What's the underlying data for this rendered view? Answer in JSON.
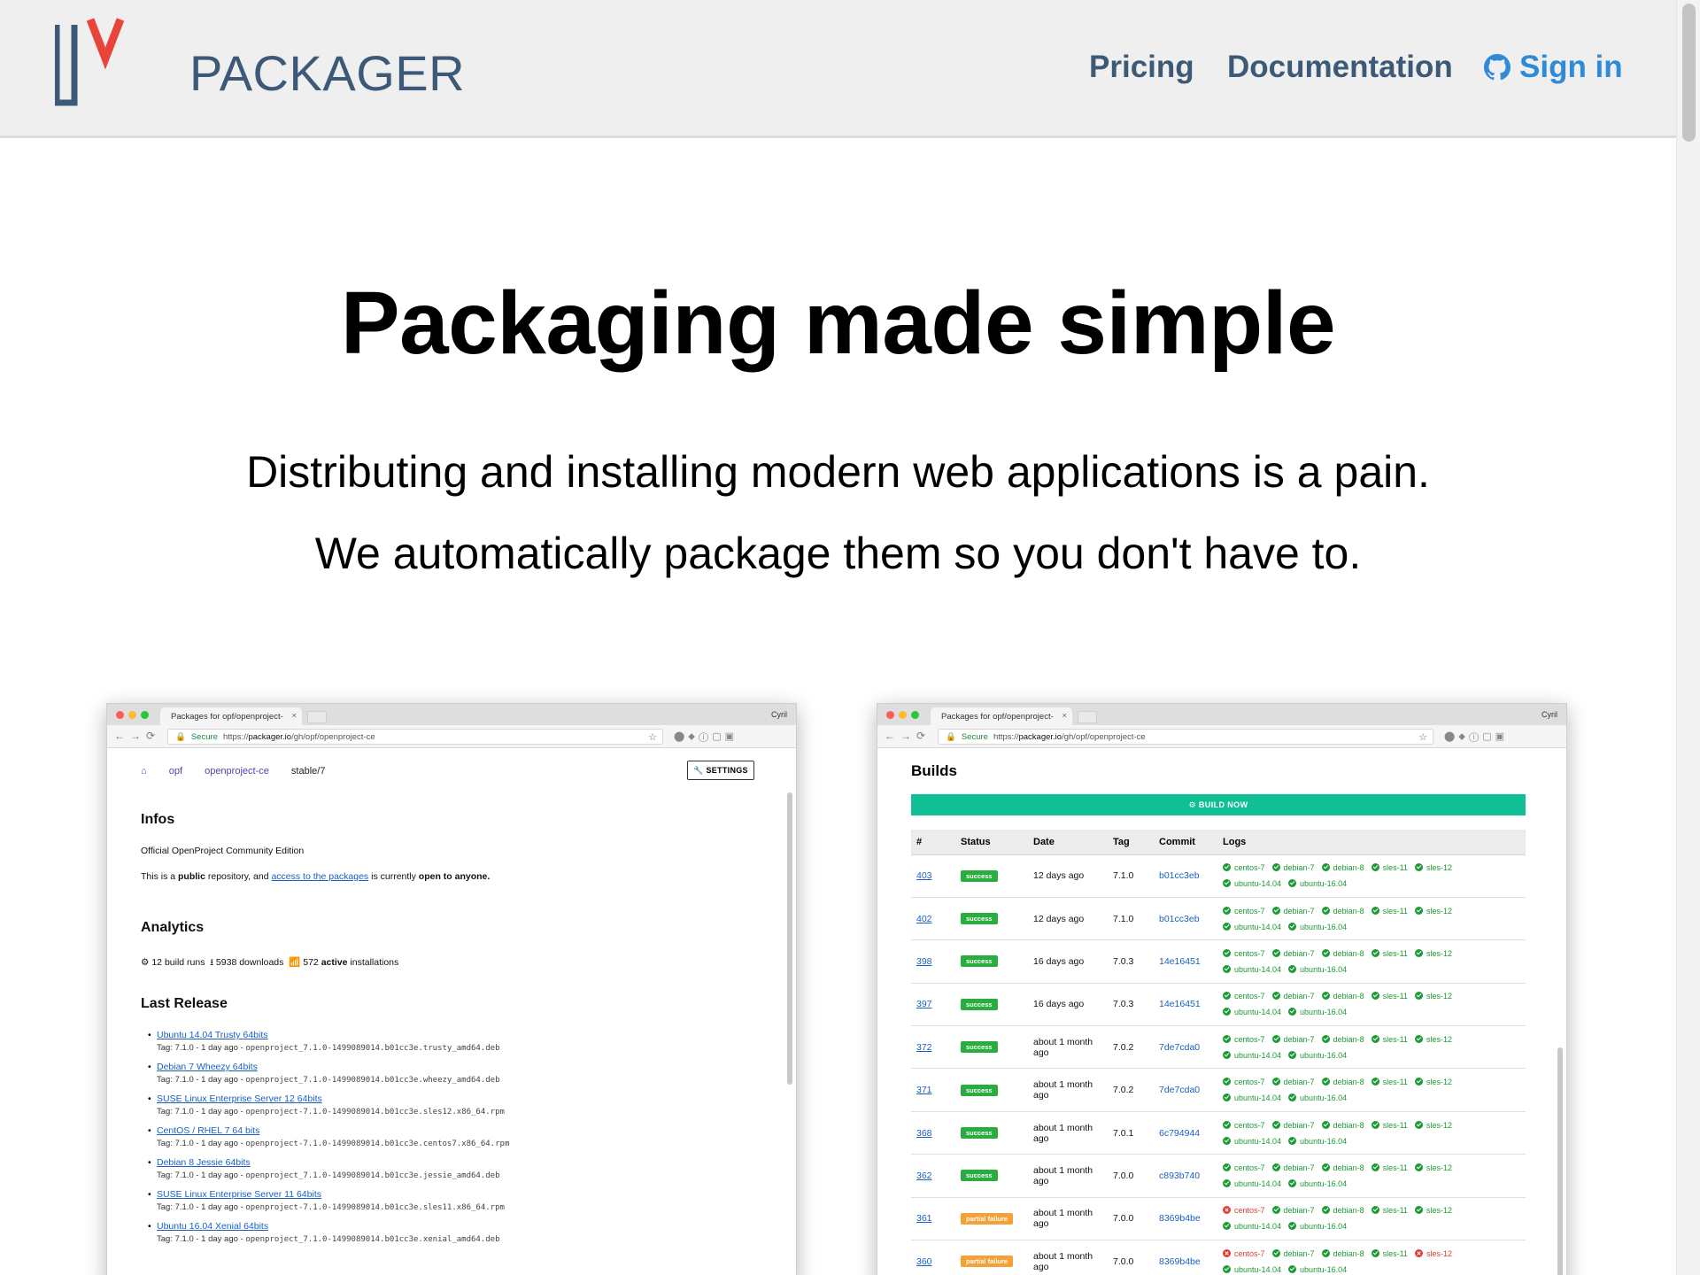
{
  "nav": {
    "brand": "PACKAGER",
    "links": {
      "pricing": "Pricing",
      "documentation": "Documentation",
      "signin": "Sign in"
    }
  },
  "hero": {
    "title": "Packaging made simple",
    "line1": "Distributing and installing modern web applications is a pain.",
    "line2": "We automatically package them so you don't have to."
  },
  "colors": {
    "brand_blue": "#3c5a78",
    "logo_red": "#e8443a",
    "signin_blue": "#2f8ad8",
    "build_green": "#10c095"
  },
  "browser": {
    "tab_title": "Packages for opf/openproject-",
    "user": "Cyril",
    "secure": "Secure",
    "url_scheme": "https://",
    "url_host": "packager.io",
    "url_path": "/gh/opf/openproject-ce"
  },
  "left_shot": {
    "breadcrumb": {
      "org": "opf",
      "repo": "openproject-ce",
      "branch": "stable/7"
    },
    "settings_label": "SETTINGS",
    "infos_heading": "Infos",
    "description": "Official OpenProject Community Edition",
    "access": {
      "prefix": "This is a ",
      "public": "public",
      "mid": " repository, and ",
      "link": "access to the packages",
      "suffix": " is currently ",
      "open": "open to anyone."
    },
    "analytics_heading": "Analytics",
    "analytics": {
      "runs": "12 build runs",
      "downloads": "5938 downloads",
      "installs_num": "572",
      "installs_word": "active",
      "installs_tail": "installations"
    },
    "last_release_heading": "Last Release",
    "releases": [
      {
        "name": "Ubuntu 14.04 Trusty 64bits",
        "tag": "Tag: 7.1.0 - 1 day ago - ",
        "file": "openproject_7.1.0-1499089014.b01cc3e.trusty_amd64.deb"
      },
      {
        "name": "Debian 7 Wheezy 64bits",
        "tag": "Tag: 7.1.0 - 1 day ago - ",
        "file": "openproject_7.1.0-1499089014.b01cc3e.wheezy_amd64.deb"
      },
      {
        "name": "SUSE Linux Enterprise Server 12 64bits",
        "tag": "Tag: 7.1.0 - 1 day ago - ",
        "file": "openproject-7.1.0-1499089014.b01cc3e.sles12.x86_64.rpm"
      },
      {
        "name": "CentOS / RHEL 7 64 bits",
        "tag": "Tag: 7.1.0 - 1 day ago - ",
        "file": "openproject-7.1.0-1499089014.b01cc3e.centos7.x86_64.rpm"
      },
      {
        "name": "Debian 8 Jessie 64bits",
        "tag": "Tag: 7.1.0 - 1 day ago - ",
        "file": "openproject_7.1.0-1499089014.b01cc3e.jessie_amd64.deb"
      },
      {
        "name": "SUSE Linux Enterprise Server 11 64bits",
        "tag": "Tag: 7.1.0 - 1 day ago - ",
        "file": "openproject-7.1.0-1499089014.b01cc3e.sles11.x86_64.rpm"
      },
      {
        "name": "Ubuntu 16.04 Xenial 64bits",
        "tag": "Tag: 7.1.0 - 1 day ago - ",
        "file": "openproject_7.1.0-1499089014.b01cc3e.xenial_amd64.deb"
      }
    ]
  },
  "right_shot": {
    "heading": "Builds",
    "build_now": "BUILD NOW",
    "columns": [
      "#",
      "Status",
      "Date",
      "Tag",
      "Commit",
      "Logs"
    ],
    "log_targets": [
      "centos-7",
      "debian-7",
      "debian-8",
      "sles-11",
      "sles-12",
      "ubuntu-14.04",
      "ubuntu-16.04"
    ],
    "rows": [
      {
        "num": "403",
        "status": "success",
        "date": "12 days ago",
        "tag": "7.1.0",
        "commit": "b01cc3eb",
        "failed": []
      },
      {
        "num": "402",
        "status": "success",
        "date": "12 days ago",
        "tag": "7.1.0",
        "commit": "b01cc3eb",
        "failed": []
      },
      {
        "num": "398",
        "status": "success",
        "date": "16 days ago",
        "tag": "7.0.3",
        "commit": "14e16451",
        "failed": []
      },
      {
        "num": "397",
        "status": "success",
        "date": "16 days ago",
        "tag": "7.0.3",
        "commit": "14e16451",
        "failed": []
      },
      {
        "num": "372",
        "status": "success",
        "date": "about 1 month ago",
        "tag": "7.0.2",
        "commit": "7de7cda0",
        "failed": []
      },
      {
        "num": "371",
        "status": "success",
        "date": "about 1 month ago",
        "tag": "7.0.2",
        "commit": "7de7cda0",
        "failed": []
      },
      {
        "num": "368",
        "status": "success",
        "date": "about 1 month ago",
        "tag": "7.0.1",
        "commit": "6c794944",
        "failed": []
      },
      {
        "num": "362",
        "status": "success",
        "date": "about 1 month ago",
        "tag": "7.0.0",
        "commit": "c893b740",
        "failed": []
      },
      {
        "num": "361",
        "status": "partial failure",
        "date": "about 1 month ago",
        "tag": "7.0.0",
        "commit": "8369b4be",
        "failed": [
          "centos-7"
        ]
      },
      {
        "num": "360",
        "status": "partial failure",
        "date": "about 1 month ago",
        "tag": "7.0.0",
        "commit": "8369b4be",
        "failed": [
          "centos-7",
          "sles-12"
        ]
      }
    ]
  }
}
